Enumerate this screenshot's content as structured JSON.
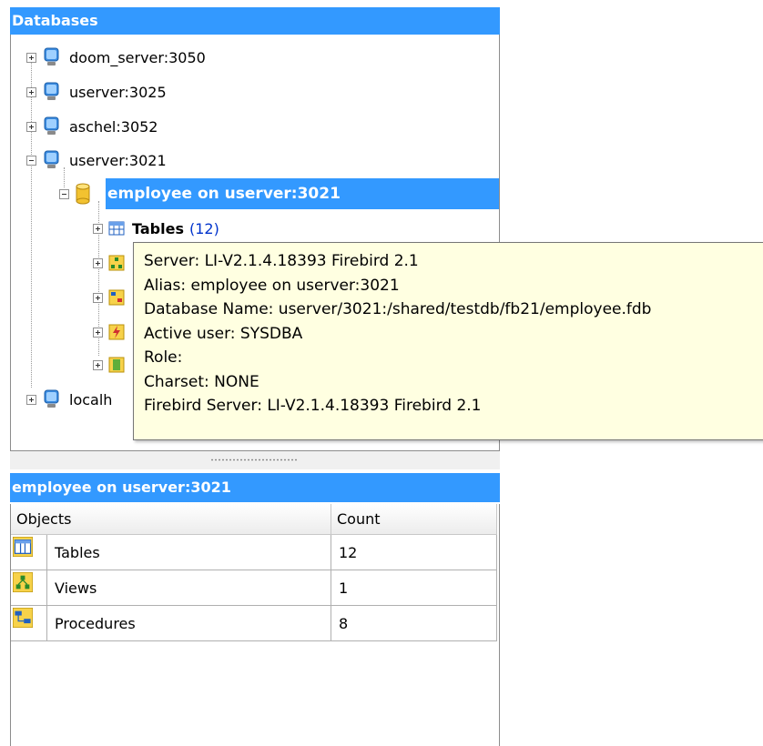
{
  "databases_header": "Databases",
  "tree": {
    "servers": [
      {
        "label": "doom_server:3050",
        "expanded": false
      },
      {
        "label": "userver:3025",
        "expanded": false
      },
      {
        "label": "aschel:3052",
        "expanded": false
      },
      {
        "label": "userver:3021",
        "expanded": true
      },
      {
        "label": "localh",
        "expanded": false
      }
    ],
    "database": {
      "label": "employee on userver:3021"
    },
    "tables": {
      "label": "Tables",
      "count": "(12)"
    }
  },
  "tooltip": {
    "lines": [
      "Server: LI-V2.1.4.18393 Firebird 2.1",
      "Alias: employee on userver:3021",
      "Database Name: userver/3021:/shared/testdb/fb21/employee.fdb",
      "Active user: SYSDBA",
      "Role:",
      "Charset: NONE",
      "Firebird Server: LI-V2.1.4.18393 Firebird 2.1"
    ]
  },
  "bottom": {
    "header": "employee on userver:3021",
    "columns": {
      "objects": "Objects",
      "count": "Count"
    },
    "rows": [
      {
        "name": "Tables",
        "count": "12",
        "icon": "table-icon"
      },
      {
        "name": "Views",
        "count": "1",
        "icon": "view-icon"
      },
      {
        "name": "Procedures",
        "count": "8",
        "icon": "procedure-icon"
      }
    ]
  },
  "colors": {
    "accent": "#3399ff",
    "tooltip_bg": "#ffffe1",
    "count": "#0033cc"
  }
}
